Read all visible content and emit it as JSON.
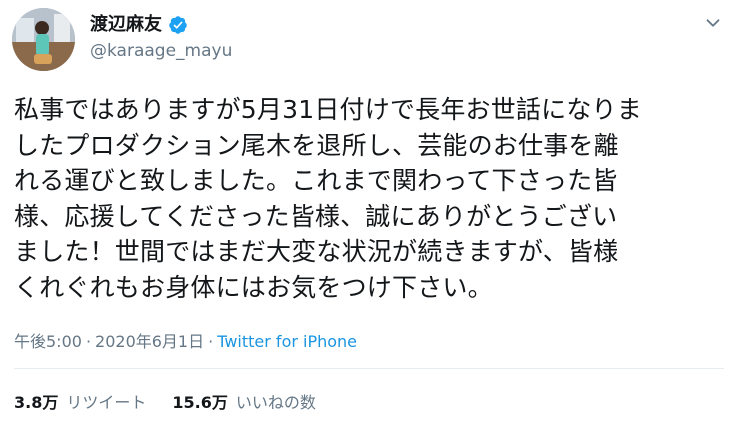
{
  "user": {
    "display_name": "渡辺麻友",
    "username": "@karaage_mayu",
    "verified": true
  },
  "tweet": {
    "lines": [
      "私事ではありますが5月31日付けで長年お世話になりま",
      "したプロダクション尾木を退所し、芸能のお仕事を離",
      "れる運びと致しました。これまで関わって下さった皆",
      "様、応援してくださった皆様、誠にありがとうござい",
      "ました！世間ではまだ大変な状況が続きますが、皆様",
      "くれぐれもお身体にはお気をつけ下さい。"
    ]
  },
  "meta": {
    "time": "午後5:00",
    "separator1": "·",
    "date": "2020年6月1日",
    "separator2": "·",
    "source": "Twitter for iPhone"
  },
  "stats": {
    "retweets_count": "3.8万",
    "retweets_label": "リツイート",
    "likes_count": "15.6万",
    "likes_label": "いいねの数"
  },
  "icons": {
    "verified": "verified-badge-icon",
    "menu": "chevron-down-icon"
  },
  "colors": {
    "text": "#14171a",
    "secondary": "#657786",
    "link": "#1b95e0",
    "verified": "#1da1f2",
    "divider": "#e6ecf0"
  }
}
